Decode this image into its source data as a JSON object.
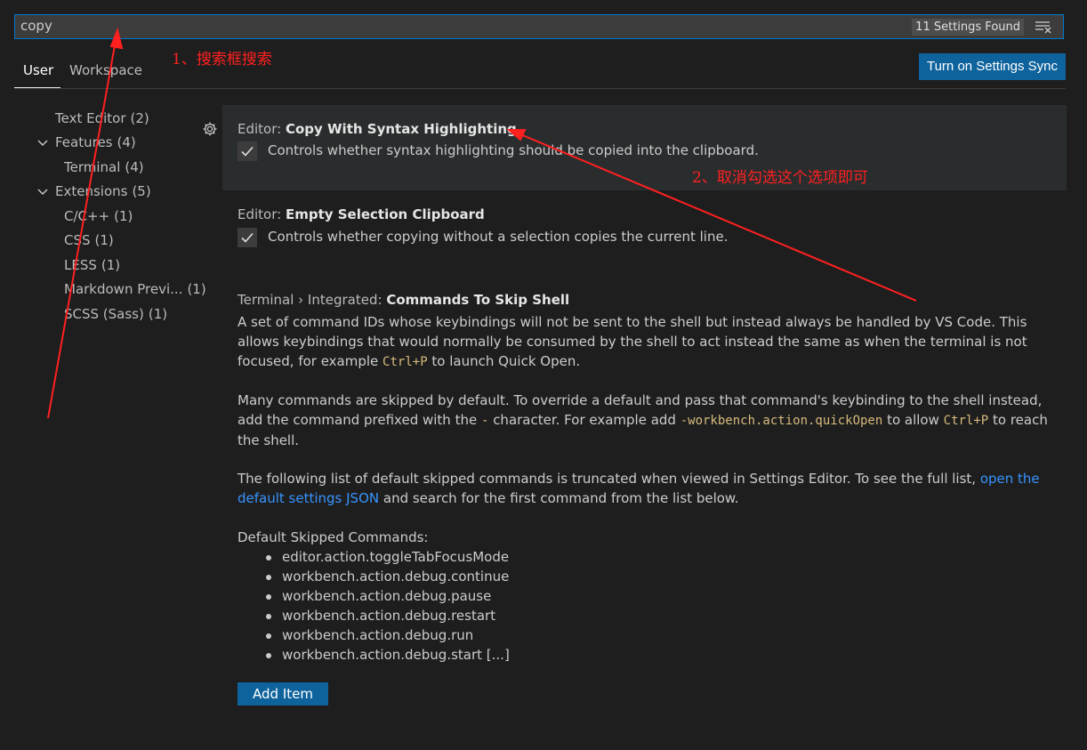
{
  "search": {
    "value": "copy",
    "found": "11 Settings Found"
  },
  "tabs": {
    "user": "User",
    "workspace": "Workspace"
  },
  "sync_button": "Turn on Settings Sync",
  "toc": [
    {
      "label": "Text Editor",
      "count": "(2)"
    },
    {
      "label": "Features",
      "count": "(4)"
    },
    {
      "label": "Terminal",
      "count": "(4)"
    },
    {
      "label": "Extensions",
      "count": "(5)"
    },
    {
      "label": "C/C++",
      "count": "(1)"
    },
    {
      "label": "CSS",
      "count": "(1)"
    },
    {
      "label": "LESS",
      "count": "(1)"
    },
    {
      "label": "Markdown Previ...",
      "count": "(1)"
    },
    {
      "label": "SCSS (Sass)",
      "count": "(1)"
    }
  ],
  "settings": [
    {
      "category": "Editor: ",
      "name": "Copy With Syntax Highlighting",
      "description": "Controls whether syntax highlighting should be copied into the clipboard.",
      "checked": true
    },
    {
      "category": "Editor: ",
      "name": "Empty Selection Clipboard",
      "description": "Controls whether copying without a selection copies the current line.",
      "checked": true
    },
    {
      "category": "Terminal › Integrated: ",
      "name": "Commands To Skip Shell",
      "p1_a": "A set of command IDs whose keybindings will not be sent to the shell but instead always be handled by VS Code. This allows keybindings that would normally be consumed by the shell to act instead the same as when the terminal is not focused, for example ",
      "p1_code": "Ctrl+P",
      "p1_b": " to launch Quick Open.",
      "p2_a": "Many commands are skipped by default. To override a default and pass that command's keybinding to the shell instead, add the command prefixed with the ",
      "p2_code1": "-",
      "p2_b": " character. For example add ",
      "p2_code2": "-workbench.action.quickOpen",
      "p2_c": " to allow ",
      "p2_code3": "Ctrl+P",
      "p2_d": " to reach the shell.",
      "p3_a": "The following list of default skipped commands is truncated when viewed in Settings Editor. To see the full list, ",
      "p3_link": "open the default settings JSON",
      "p3_b": " and search for the first command from the list below.",
      "list_heading": "Default Skipped Commands:",
      "commands": [
        "editor.action.toggleTabFocusMode",
        "workbench.action.debug.continue",
        "workbench.action.debug.pause",
        "workbench.action.debug.restart",
        "workbench.action.debug.run",
        "workbench.action.debug.start [...]"
      ],
      "add_item": "Add Item"
    }
  ],
  "annotations": {
    "note1": "1、搜索框搜索",
    "note2": "2、取消勾选这个选项即可",
    "color": "#ff2020"
  },
  "colors": {
    "background": "#1e1e1e",
    "accent": "#007acc",
    "button": "#0e639c",
    "link": "#3794ff",
    "code": "#d7ba7d"
  }
}
